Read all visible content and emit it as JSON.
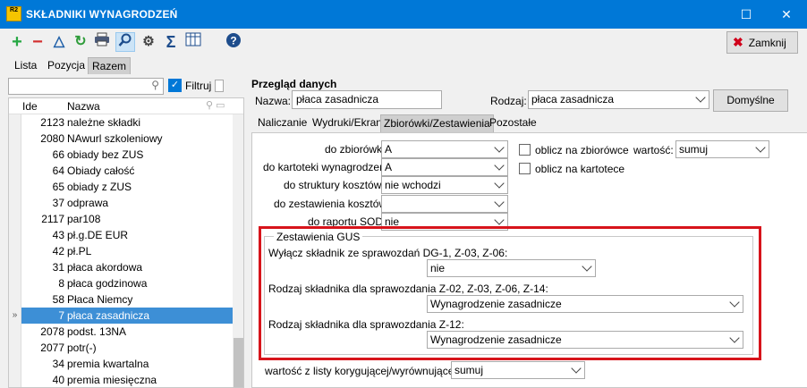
{
  "window": {
    "title": "SKŁADNIKI WYNAGRODZEŃ",
    "logo": "R2"
  },
  "toolbar": {
    "icons": [
      "add-icon",
      "delete-icon",
      "filter-icon",
      "refresh-icon",
      "print-icon",
      "search-icon",
      "settings-icon",
      "sum-icon",
      "columns-icon",
      "help-icon"
    ],
    "close_label": "Zamknij"
  },
  "top_tabs": [
    "Lista",
    "Pozycja",
    "Razem"
  ],
  "left": {
    "search_value": "",
    "filter_label": "Filtruj",
    "columns": {
      "ide": "Ide",
      "nazwa": "Nazwa"
    },
    "rows": [
      {
        "ide": "2123",
        "nazwa": "należne składki"
      },
      {
        "ide": "2080",
        "nazwa": "NAwurl szkoleniowy"
      },
      {
        "ide": "66",
        "nazwa": "obiady bez ZUS"
      },
      {
        "ide": "64",
        "nazwa": "Obiady całość"
      },
      {
        "ide": "65",
        "nazwa": "obiady z ZUS"
      },
      {
        "ide": "37",
        "nazwa": "odprawa"
      },
      {
        "ide": "2117",
        "nazwa": "par108"
      },
      {
        "ide": "43",
        "nazwa": "pł.g.DE EUR"
      },
      {
        "ide": "42",
        "nazwa": "pł.PL"
      },
      {
        "ide": "31",
        "nazwa": "płaca akordowa"
      },
      {
        "ide": "8",
        "nazwa": "płaca godzinowa"
      },
      {
        "ide": "58",
        "nazwa": "Płaca Niemcy"
      },
      {
        "ide": "7",
        "nazwa": "płaca zasadnicza"
      },
      {
        "ide": "2078",
        "nazwa": "podst. 13NA"
      },
      {
        "ide": "2077",
        "nazwa": "potr(-)"
      },
      {
        "ide": "34",
        "nazwa": "premia kwartalna"
      },
      {
        "ide": "40",
        "nazwa": "premia miesięczna"
      }
    ],
    "selected_index": 12
  },
  "right": {
    "section_title": "Przegląd danych",
    "nazwa_label": "Nazwa:",
    "nazwa_value": "płaca zasadnicza",
    "rodzaj_label": "Rodzaj:",
    "rodzaj_value": "płaca zasadnicza",
    "default_button": "Domyślne",
    "tabs": [
      "Naliczanie",
      "Wydruki/Ekran",
      "Zbiorówki/Zestawienia",
      "Pozostałe"
    ],
    "active_tab": 2,
    "fields": [
      {
        "label": "do zbiorówki:",
        "value": "A"
      },
      {
        "label": "do kartoteki wynagrodzeń:",
        "value": "A"
      },
      {
        "label": "do struktury kosztów:",
        "value": "nie wchodzi"
      },
      {
        "label": "do zestawienia kosztów:",
        "value": ""
      },
      {
        "label": "do raportu SOD:",
        "value": "nie"
      }
    ],
    "oblicz_zbiorowce_label": "oblicz na zbiorówce",
    "oblicz_kartotece_label": "oblicz na kartotece",
    "wartosc_label": "wartość:",
    "wartosc_value": "sumuj",
    "gus": {
      "title": "Zestawienia GUS",
      "q1_label": "Wyłącz składnik ze sprawozdań DG-1, Z-03, Z-06:",
      "q1_value": "nie",
      "q2_label": "Rodzaj składnika dla sprawozdania Z-02, Z-03, Z-06, Z-14:",
      "q2_value": "Wynagrodzenie zasadnicze",
      "q3_label": "Rodzaj składnika dla sprawozdania Z-12:",
      "q3_value": "Wynagrodzenie zasadnicze"
    },
    "korygujaca_label": "wartość z listy korygującej/wyrównującej:",
    "korygujaca_value": "sumuj"
  },
  "colors": {
    "titlebar": "#0078d7",
    "selection": "#3d8fd6",
    "highlight_frame": "#d7141b"
  }
}
